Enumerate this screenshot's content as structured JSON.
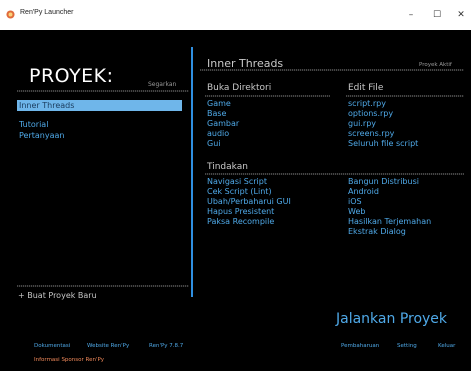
{
  "window": {
    "title": "Ren'Py Launcher",
    "icon": "renpy-icon",
    "controls": {
      "minimize": "–",
      "maximize": "☐",
      "close": "✕"
    }
  },
  "left": {
    "title": "PROYEK:",
    "refresh": "Segarkan",
    "projects": [
      "Inner Threads"
    ],
    "extras": [
      "Tutorial",
      "Pertanyaan"
    ],
    "new_project": "+ Buat Proyek Baru"
  },
  "right": {
    "project_title": "Inner Threads",
    "active_label": "Proyek Aktif",
    "open_directory": {
      "heading": "Buka Direktori",
      "items": [
        "Game",
        "Base",
        "Gambar",
        "audio",
        "Gui"
      ]
    },
    "edit_file": {
      "heading": "Edit File",
      "items": [
        "script.rpy",
        "options.rpy",
        "gui.rpy",
        "screens.rpy",
        "Seluruh file script"
      ]
    },
    "actions": {
      "heading": "Tindakan",
      "left": [
        "Navigasi Script",
        "Cek Script (Lint)",
        "Ubah/Perbaharui GUI",
        "Hapus Presistent",
        "Paksa Recompile"
      ],
      "right": [
        "Bangun Distribusi",
        "Android",
        "iOS",
        "Web",
        "Hasilkan Terjemahan",
        "Ekstrak Dialog"
      ]
    },
    "launch": "Jalankan Proyek"
  },
  "footer": {
    "docs": "Dokumentasi",
    "website": "Website Ren'Py",
    "version": "Ren'Py 7.8.7",
    "sponsor": "Informasi Sponsor Ren'Py",
    "update": "Pembaharuan",
    "settings": "Setting",
    "quit": "Keluar"
  },
  "colors": {
    "accent": "#4fa9e8",
    "selected_bg": "#6fb6ea",
    "sponsor": "#f28a5b",
    "background": "#000000"
  }
}
